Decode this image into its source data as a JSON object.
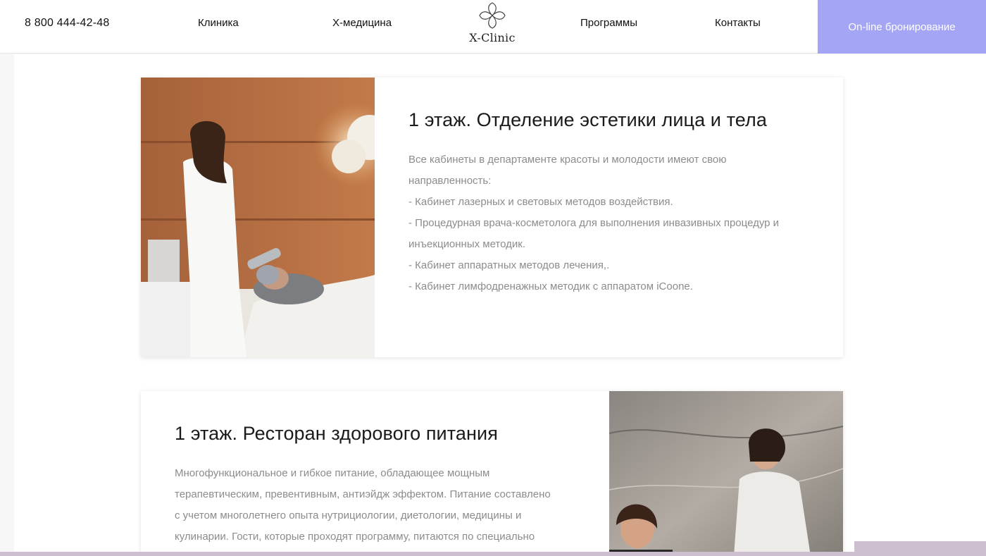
{
  "header": {
    "phone": "8 800 444-42-48",
    "nav": [
      "Клиника",
      "X-медицина",
      "Программы",
      "Контакты"
    ],
    "logo_text": "X-Clinic",
    "booking_label": "On-line бронирование"
  },
  "colors": {
    "accent": "#a5a5f5",
    "body_text": "#8c8c8c",
    "title_text": "#1a1a1a"
  },
  "sections": [
    {
      "title": "1 этаж. Отделение эстетики лица и тела",
      "lines": [
        "Все кабинеты в департаменте красоты и молодости имеют свою",
        "направленность:",
        "- Кабинет лазерных и световых методов воздействия.",
        "- Процедурная врача-косметолога для выполнения инвазивных процедур и",
        "инъекционных методик.",
        "- Кабинет аппаратных методов лечения,.",
        "- Кабинет лимфодренажных методик с аппаратом iCoone."
      ]
    },
    {
      "title": "1 этаж. Ресторан здорового питания",
      "lines": [
        "Многофункциональное и гибкое питание, обладающее мощным",
        "терапевтическим, превентивным, антиэйдж эффектом. Питание составлено",
        "с учетом многолетнего опыта нутрициологии, диетологии, медицины и",
        "кулинарии. Гости, которые проходят программу, питаются по специально"
      ]
    }
  ]
}
